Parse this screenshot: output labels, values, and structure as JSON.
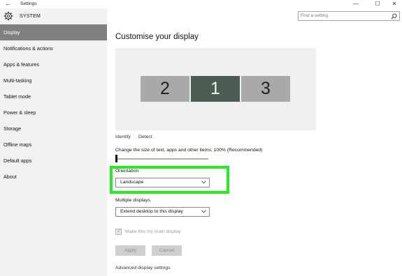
{
  "window": {
    "back_glyph": "←",
    "title": "Settings",
    "minimize_glyph": "—",
    "maximize_glyph": "☐",
    "close_glyph": "✕"
  },
  "sidebar": {
    "header_title": "SYSTEM",
    "header_icon": "gear-icon",
    "items": [
      {
        "label": "Display",
        "active": true
      },
      {
        "label": "Notifications & actions",
        "active": false
      },
      {
        "label": "Apps & features",
        "active": false
      },
      {
        "label": "Multi-tasking",
        "active": false
      },
      {
        "label": "Tablet mode",
        "active": false
      },
      {
        "label": "Power & sleep",
        "active": false
      },
      {
        "label": "Storage",
        "active": false
      },
      {
        "label": "Offline maps",
        "active": false
      },
      {
        "label": "Default apps",
        "active": false
      },
      {
        "label": "About",
        "active": false
      }
    ]
  },
  "search": {
    "placeholder": "Find a setting",
    "icon": "search-icon"
  },
  "main": {
    "title": "Customise your display",
    "monitors": [
      "2",
      "1",
      "3"
    ],
    "identify_label": "Identify",
    "detect_label": "Detect",
    "scale_label": "Change the size of text, apps and other items: 100% (Recommended)",
    "scale_value_percent": 100,
    "orientation": {
      "label": "Orientation",
      "value": "Landscape"
    },
    "multiple_displays": {
      "label": "Multiple displays",
      "value": "Extend desktop to this display"
    },
    "main_display": {
      "label": "Make this my main display",
      "checked": true,
      "disabled": true
    },
    "apply_label": "Apply",
    "cancel_label": "Cancel",
    "advanced_label": "Advanced display settings"
  },
  "colors": {
    "active_nav": "#808080",
    "highlight": "#22ee22",
    "selected_monitor": "#4b5c52",
    "monitor": "#a9a9a9"
  }
}
